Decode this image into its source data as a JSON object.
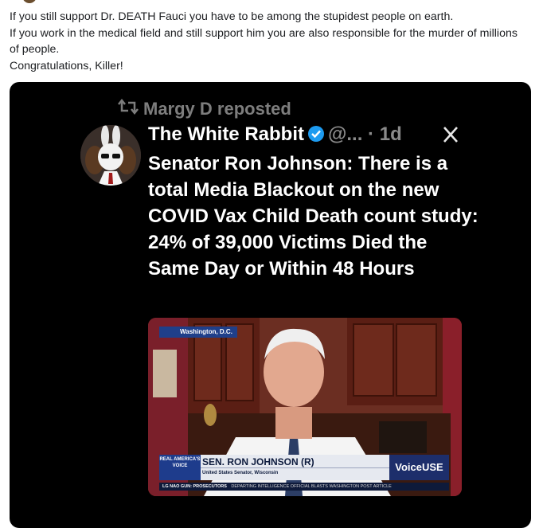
{
  "post": {
    "lines": [
      "If you still support Dr. DEATH Fauci you have to be among the stupidest people on earth.",
      "If you work in the medical field and still support him you are also responsible for the murder of millions of people.",
      "Congratulations, Killer!"
    ]
  },
  "tweet": {
    "reposted_by": "Margy D reposted",
    "display_name": "The White Rabbit",
    "handle_time": "@... · 1d",
    "text": "Senator Ron Johnson: There is a total Media Blackout on the new COVID Vax Child Death count study: 24% of 39,000 Victims Died the Same Day or Within 48 Hours"
  },
  "video": {
    "location": "Washington, D.C.",
    "chyron_left": "REAL AMERICA'S VOICE",
    "name": "SEN. RON JOHNSON (R)",
    "title": "United States Senator, Wisconsin",
    "network": "VoiceUSE",
    "ticker_tag": "LG NAO GUN: PROSECUTORS",
    "ticker": "DEPARTING INTELLIGENCE OFFICIAL BLASTS WASHINGTON POST ARTICLE"
  },
  "colors": {
    "embed_bg": "#000000",
    "verified": "#1d9bf0",
    "muted": "#7d7d7d"
  }
}
